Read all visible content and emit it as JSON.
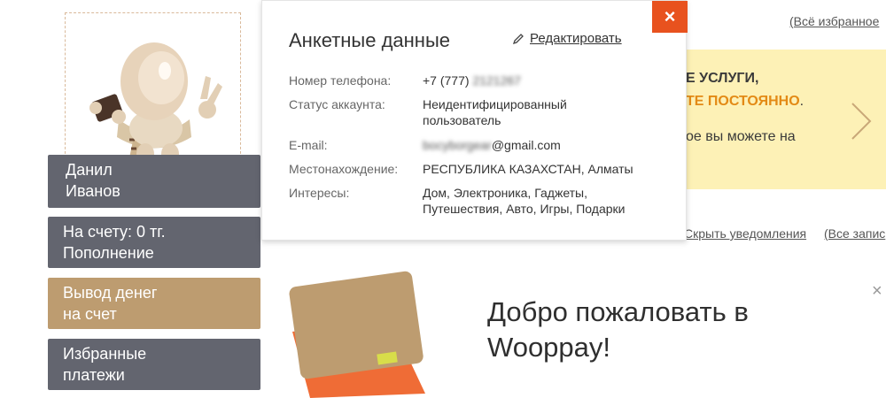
{
  "sidebar": {
    "user": {
      "first_name": "Данил",
      "last_name": "Иванов"
    },
    "balance": {
      "line1": "На счету: 0 тг.",
      "line2": "Пополнение"
    },
    "withdraw": {
      "line1": "Вывод денег",
      "line2": "на счет"
    },
    "favorites": {
      "line1": "Избранные",
      "line2": "платежи"
    }
  },
  "header": {
    "all_favorites_link": "(Всё избранное"
  },
  "promo": {
    "line1": "Е УСЛУГИ,",
    "line2": "ТЕ ПОСТОЯННО",
    "line2_suffix": ".",
    "line3": "ое вы можете на"
  },
  "notifications": {
    "hide_link": "Скрыть уведомления",
    "all_records_link": "(Все запис"
  },
  "welcome": {
    "title": "Добро пожаловать в Wooppay!"
  },
  "profile_popup": {
    "title": "Анкетные данные",
    "edit_label": "Редактировать",
    "close_symbol": "×",
    "fields": {
      "phone": {
        "label": "Номер телефона:",
        "value_visible": "+7 (777)",
        "value_hidden": "2121267"
      },
      "status": {
        "label": "Статус аккаунта:",
        "value": "Неидентифицированный пользователь"
      },
      "email": {
        "label": "E-mail:",
        "value_hidden": "bocyborgear",
        "value_visible": "@gmail.com"
      },
      "location": {
        "label": "Местонахождение:",
        "value": "РЕСПУБЛИКА КАЗАХСТАН, Алматы"
      },
      "interests": {
        "label": "Интересы:",
        "value": "Дом, Электроника, Гаджеты, Путешествия, Авто, Игры, Подарки"
      }
    }
  },
  "colors": {
    "sidebar_gray": "#63656f",
    "sidebar_tan": "#bd9c70",
    "close_button": "#e8521e",
    "promo_bg": "#fdf1b6",
    "promo_accent": "#e38a15"
  },
  "icons": {
    "edit": "pencil-icon",
    "close": "close-icon",
    "promo_next": "chevron-right-icon",
    "mascot": "mascot-avatar",
    "wallet": "wallet-illustration"
  }
}
